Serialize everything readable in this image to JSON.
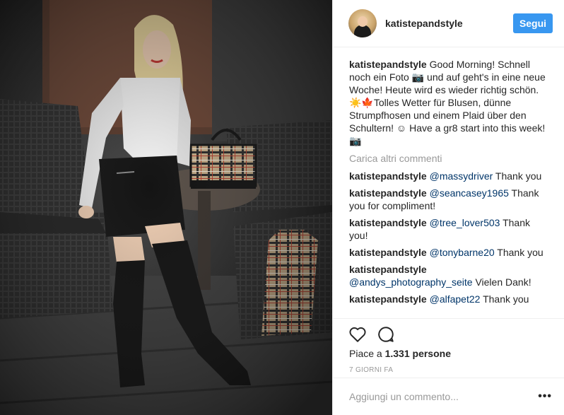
{
  "header": {
    "username": "katistepandstyle",
    "follow_label": "Segui"
  },
  "caption": {
    "username": "katistepandstyle",
    "text": "Good Morning! Schnell noch ein Foto 📷 und auf geht's in eine neue Woche! Heute wird es wieder richtig schön.☀️🍁Tolles Wetter für Blusen, dünne Strumpfhosen und einem Plaid über den Schultern! ☺ Have a gr8 start into this week! 📷"
  },
  "load_more": "Carica altri commenti",
  "comments": [
    {
      "username": "katistepandstyle",
      "mention": "@massydriver",
      "text": " Thank you"
    },
    {
      "username": "katistepandstyle",
      "mention": "@seancasey1965",
      "text": " Thank you for compliment!"
    },
    {
      "username": "katistepandstyle",
      "mention": "@tree_lover503",
      "text": " Thank you!"
    },
    {
      "username": "katistepandstyle",
      "mention": "@tonybarne20",
      "text": " Thank you"
    },
    {
      "username": "katistepandstyle",
      "mention": "@andys_photography_seite",
      "text": " Vielen Dank!"
    },
    {
      "username": "katistepandstyle",
      "mention": "@alfapet22",
      "text": " Thank you"
    }
  ],
  "likes": {
    "prefix": "Piace a ",
    "count": "1.331 persone"
  },
  "time_ago": "7 GIORNI FA",
  "add_comment": {
    "placeholder": "Aggiungi un commento...",
    "more": "•••"
  },
  "icons": {
    "like": "heart-icon",
    "comment": "speech-bubble-icon",
    "more": "more-options-icon"
  },
  "colors": {
    "accent": "#3897f0",
    "mention": "#003569",
    "muted": "#999999",
    "text": "#262626"
  }
}
